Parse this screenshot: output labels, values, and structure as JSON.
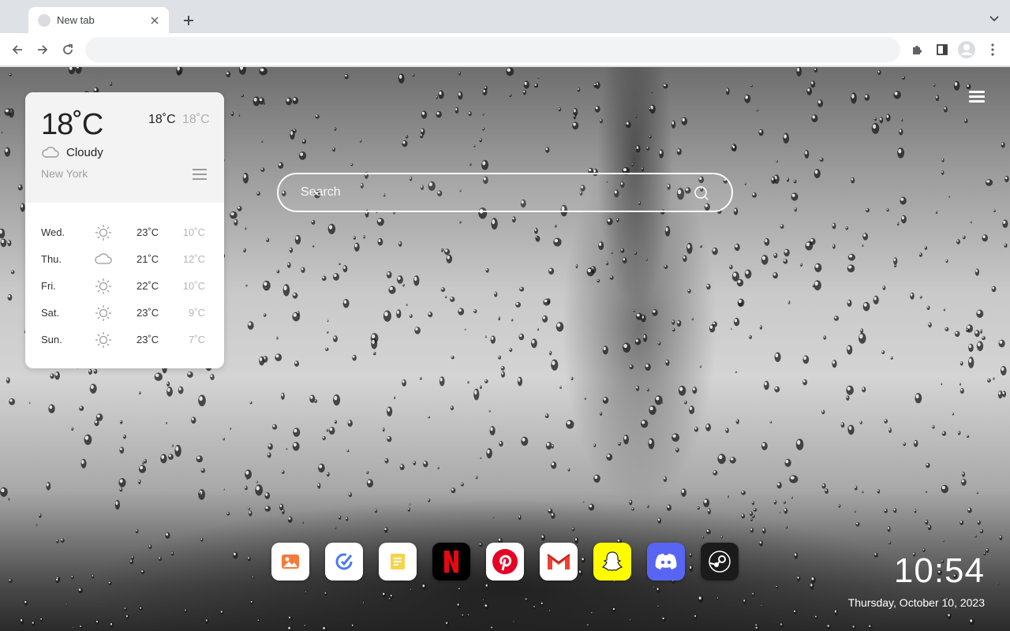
{
  "browser": {
    "tab_title": "New tab",
    "omnibox_value": "",
    "omnibox_placeholder": ""
  },
  "weather": {
    "current_temp": "18˚C",
    "high": "18˚C",
    "low": "18˚C",
    "condition": "Cloudy",
    "condition_icon": "cloud-icon",
    "city": "New York",
    "forecast": [
      {
        "day": "Wed.",
        "icon": "sun-icon",
        "high": "23˚C",
        "low": "10˚C"
      },
      {
        "day": "Thu.",
        "icon": "cloud-icon",
        "high": "21˚C",
        "low": "12˚C"
      },
      {
        "day": "Fri.",
        "icon": "sun-icon",
        "high": "22˚C",
        "low": "10˚C"
      },
      {
        "day": "Sat.",
        "icon": "sun-icon",
        "high": "23˚C",
        "low": "9˚C"
      },
      {
        "day": "Sun.",
        "icon": "sun-icon",
        "high": "23˚C",
        "low": "7˚C"
      }
    ]
  },
  "search": {
    "placeholder": "Search"
  },
  "dock": {
    "apps": [
      {
        "name": "Photos",
        "icon": "image-icon",
        "color": "#ffffff"
      },
      {
        "name": "Tasks",
        "icon": "check-circle-icon",
        "color": "#ffffff"
      },
      {
        "name": "Notes",
        "icon": "note-icon",
        "color": "#ffffff"
      },
      {
        "name": "Netflix",
        "icon": "netflix-icon",
        "color": "#000000"
      },
      {
        "name": "Pinterest",
        "icon": "pinterest-icon",
        "color": "#ffffff"
      },
      {
        "name": "Gmail",
        "icon": "gmail-icon",
        "color": "#ffffff"
      },
      {
        "name": "Snapchat",
        "icon": "snapchat-icon",
        "color": "#fffc00"
      },
      {
        "name": "Discord",
        "icon": "discord-icon",
        "color": "#5865f2"
      },
      {
        "name": "Steam",
        "icon": "steam-icon",
        "color": "#1b1b1b"
      }
    ]
  },
  "clock": {
    "time": "10:54",
    "date": "Thursday, October 10, 2023"
  }
}
